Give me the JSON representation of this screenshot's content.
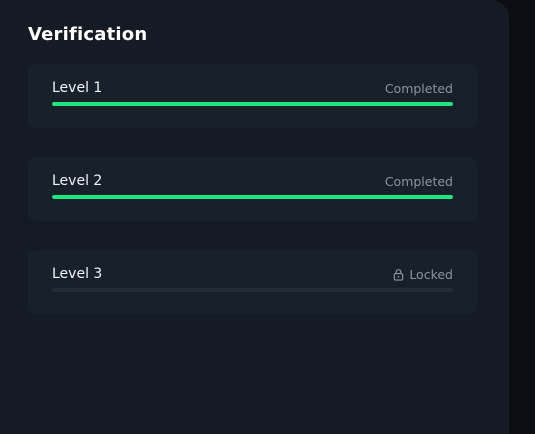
{
  "verification": {
    "title": "Verification",
    "levels": [
      {
        "label": "Level 1",
        "status": "Completed",
        "progress": 1.0
      },
      {
        "label": "Level 2",
        "status": "Completed",
        "progress": 1.0
      },
      {
        "label": "Level 3",
        "status": "Locked",
        "progress": 0.0,
        "icon": "lock-icon"
      }
    ]
  },
  "colors": {
    "accent": "#1fe682",
    "panel": "#141b24",
    "card": "#18202a"
  }
}
